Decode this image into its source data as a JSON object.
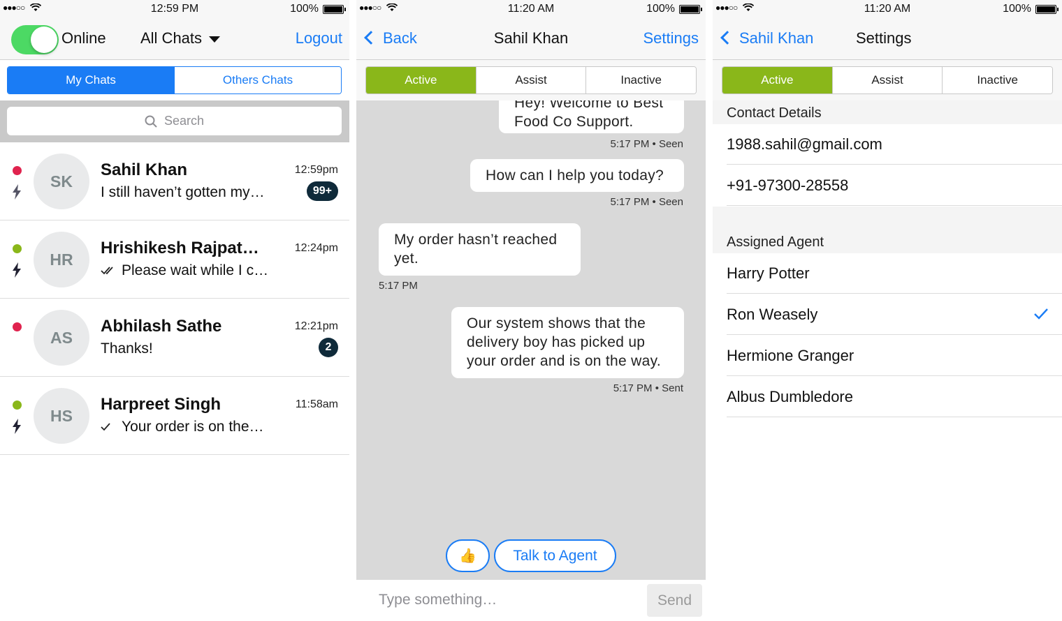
{
  "colors": {
    "ios_blue": "#1a7cf5",
    "active_green": "#8ab71a",
    "toggle_green": "#4cd964",
    "presence_red": "#e0234e",
    "presence_green": "#8ab71a",
    "badge_dark": "#0f2a3a"
  },
  "screen1": {
    "status": {
      "time": "12:59 PM",
      "battery": "100%"
    },
    "nav": {
      "status_label": "Online",
      "filter_label": "All Chats",
      "logout_label": "Logout"
    },
    "tabs": [
      "My Chats",
      "Others Chats"
    ],
    "search": {
      "placeholder": "Search"
    },
    "chats": [
      {
        "initials": "SK",
        "name": "Sahil Khan",
        "preview": "I still haven’t gotten my…",
        "time": "12:59pm",
        "badge": "99+",
        "presence": "red",
        "tick": "none",
        "icon": "bolt-icon"
      },
      {
        "initials": "HR",
        "name": "Hrishikesh Rajpat…",
        "preview": "Please wait while I c…",
        "time": "12:24pm",
        "badge": "",
        "presence": "green",
        "tick": "double",
        "icon": "bolt-icon"
      },
      {
        "initials": "AS",
        "name": "Abhilash Sathe",
        "preview": "Thanks!",
        "time": "12:21pm",
        "badge": "2",
        "presence": "red",
        "tick": "none",
        "icon": ""
      },
      {
        "initials": "HS",
        "name": "Harpreet Singh",
        "preview": "Your order is on the…",
        "time": "11:58am",
        "badge": "",
        "presence": "green",
        "tick": "single",
        "icon": "bolt-icon"
      }
    ]
  },
  "screen2": {
    "status": {
      "time": "11:20 AM",
      "battery": "100%"
    },
    "nav": {
      "back_label": "Back",
      "title": "Sahil Khan",
      "settings_label": "Settings"
    },
    "tabs": [
      "Active",
      "Assist",
      "Inactive"
    ],
    "messages": [
      {
        "text_line1": "Hey! Welcome to Best",
        "text_line2": "Food Co Support.",
        "meta": "5:17 PM • Seen",
        "side": "right"
      },
      {
        "text": "How can I help you today?",
        "meta": "5:17 PM • Seen",
        "side": "right"
      },
      {
        "text_line1": "My order hasn’t reached",
        "text_line2": "yet.",
        "meta": "5:17 PM",
        "side": "left"
      },
      {
        "text_line1": "Our system shows that the",
        "text_line2": "delivery boy has picked up",
        "text_line3": "your order and is on the way.",
        "meta": "5:17 PM • Sent",
        "side": "right"
      }
    ],
    "quick_replies": {
      "thumbs": "👍",
      "agent": "Talk to Agent"
    },
    "composer": {
      "placeholder": "Type something…",
      "send_label": "Send"
    }
  },
  "screen3": {
    "status": {
      "time": "11:20 AM",
      "battery": "100%"
    },
    "nav": {
      "back_label": "Sahil Khan",
      "title": "Settings"
    },
    "tabs": [
      "Active",
      "Assist",
      "Inactive"
    ],
    "contact_header": "Contact Details",
    "contact": {
      "email": "1988.sahil@gmail.com",
      "phone": "+91-97300-28558"
    },
    "agent_header": "Assigned Agent",
    "agents": [
      {
        "name": "Harry Potter",
        "selected": false
      },
      {
        "name": "Ron Weasely",
        "selected": true
      },
      {
        "name": "Hermione Granger",
        "selected": false
      },
      {
        "name": "Albus Dumbledore",
        "selected": false
      }
    ]
  }
}
